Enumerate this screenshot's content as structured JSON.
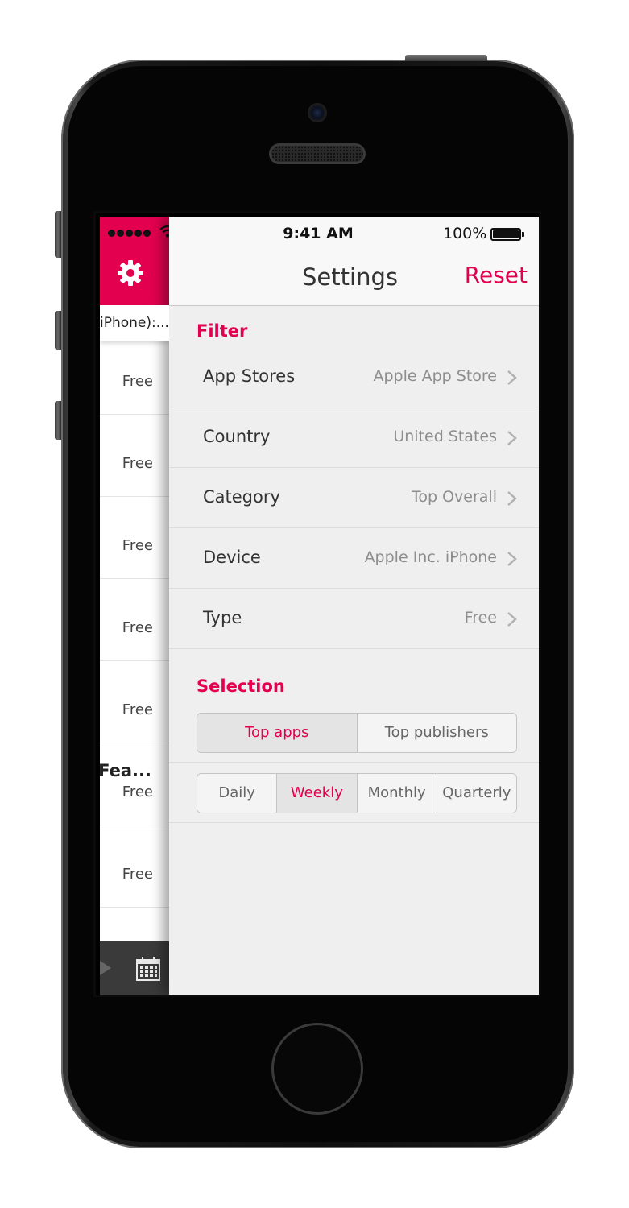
{
  "status_bar": {
    "time": "9:41 AM",
    "battery": "100%"
  },
  "drawer": {
    "subtitle": "iPhone):...",
    "rows": [
      {
        "title": "",
        "price": "Free"
      },
      {
        "title": "",
        "price": "Free"
      },
      {
        "title": "",
        "price": "Free"
      },
      {
        "title": "",
        "price": "Free"
      },
      {
        "title": "",
        "price": "Free"
      },
      {
        "title": ", Fea...",
        "price": "Free"
      },
      {
        "title": "",
        "price": "Free"
      }
    ],
    "icons": {
      "settings": "gear-icon",
      "play": "play-icon",
      "calendar": "calendar-icon"
    }
  },
  "navbar": {
    "title": "Settings",
    "reset_label": "Reset"
  },
  "filter": {
    "section_label": "Filter",
    "rows": [
      {
        "label": "App Stores",
        "value": "Apple App Store"
      },
      {
        "label": "Country",
        "value": "United States"
      },
      {
        "label": "Category",
        "value": "Top Overall"
      },
      {
        "label": "Device",
        "value": "Apple Inc. iPhone"
      },
      {
        "label": "Type",
        "value": "Free"
      }
    ]
  },
  "selection": {
    "section_label": "Selection",
    "kind": {
      "options": [
        "Top apps",
        "Top publishers"
      ],
      "selected": "Top apps"
    },
    "period": {
      "options": [
        "Daily",
        "Weekly",
        "Monthly",
        "Quarterly"
      ],
      "selected": "Weekly"
    }
  },
  "colors": {
    "accent": "#e2004f",
    "panel_bg": "#efefef",
    "navbar_bg": "#f8f8f8"
  }
}
